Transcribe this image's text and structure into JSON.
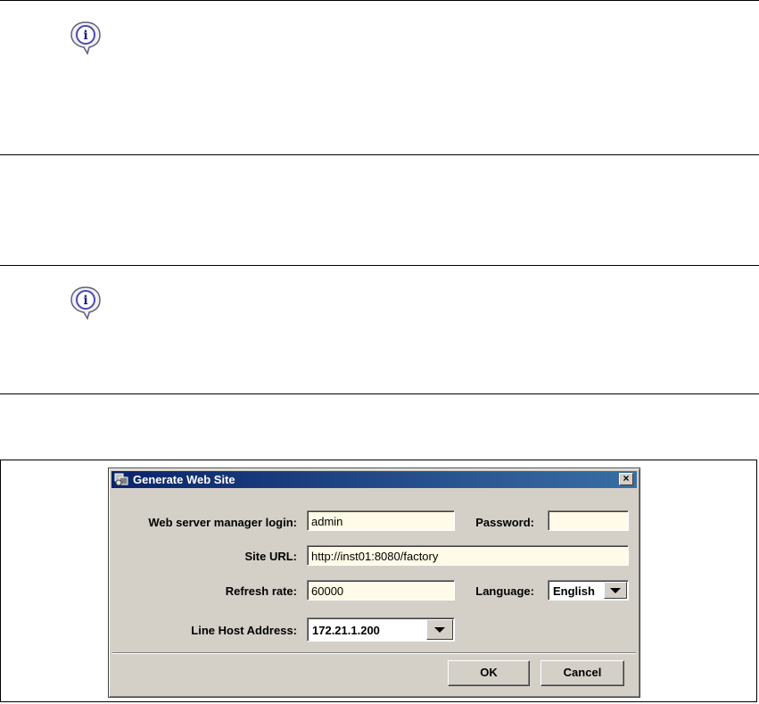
{
  "dialog": {
    "title": "Generate Web Site",
    "close_label": "×",
    "fields": {
      "login_label": "Web server manager login:",
      "login_value": "admin",
      "password_label": "Password:",
      "password_value": "",
      "site_url_label": "Site URL:",
      "site_url_value": "http://inst01:8080/factory",
      "refresh_label": "Refresh rate:",
      "refresh_value": "60000",
      "language_label": "Language:",
      "language_value": "English",
      "host_label": "Line Host Address:",
      "host_value": "172.21.1.200"
    },
    "buttons": {
      "ok": "OK",
      "cancel": "Cancel"
    }
  },
  "icons": [
    "info-icon",
    "info-icon",
    "app-icon",
    "close-icon",
    "chevron-down-icon"
  ],
  "colors": {
    "titlebar_start": "#0a246a",
    "titlebar_end": "#3a6ea5",
    "field_bg": "#fffbe8",
    "dialog_bg": "#d4d0c8"
  }
}
